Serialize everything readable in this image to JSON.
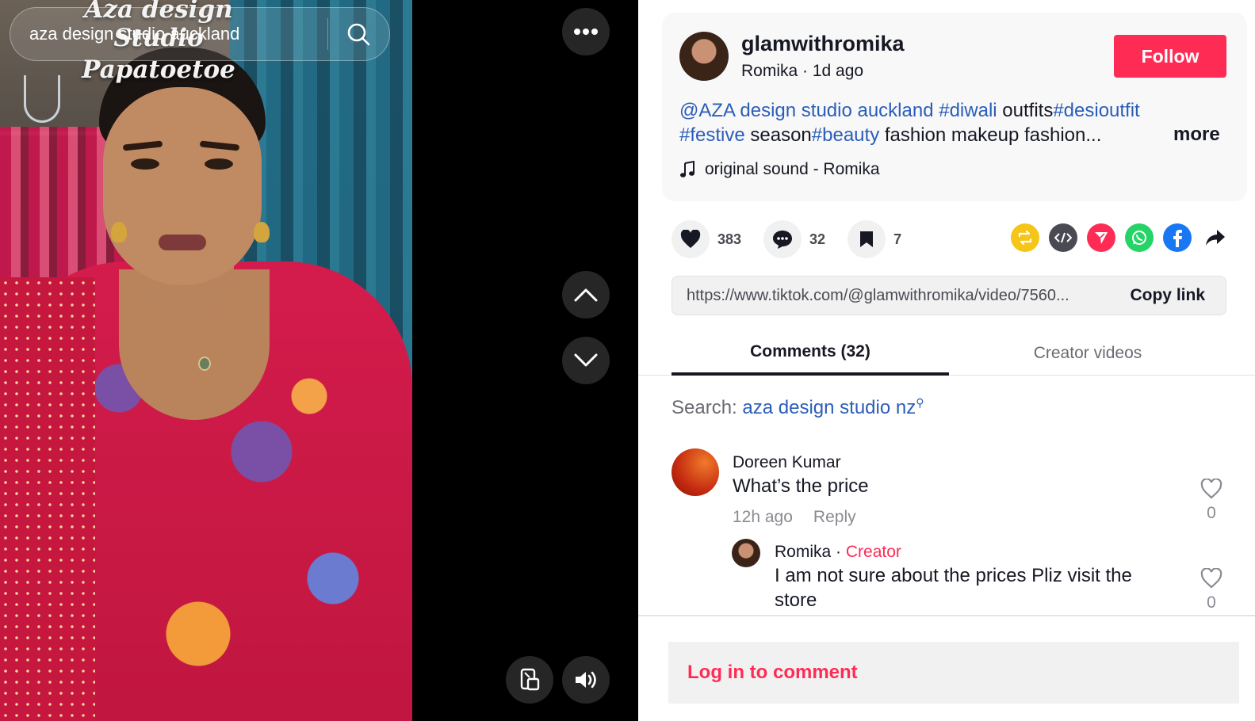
{
  "video": {
    "overlay_line1": "Aza design",
    "overlay_line2": "Studio",
    "overlay_line3": "Papatoetoe"
  },
  "search": {
    "value": "aza design studio auckland",
    "placeholder": "aza design studio auckland"
  },
  "author": {
    "username": "glamwithromika",
    "display_name": "Romika",
    "separator": " · ",
    "posted": "1d ago",
    "follow_label": "Follow"
  },
  "description": {
    "mention": "@AZA design studio auckland",
    "tag_diwali": "#diwali",
    "text_outfits": "outfits",
    "tag_desioutfit": "#desioutfit",
    "tag_festive": "#festive",
    "text_season": "season",
    "tag_beauty": "#beauty",
    "text_tail": "fashion makeup fashion...",
    "more_label": "more"
  },
  "music": {
    "label": "original sound - Romika"
  },
  "actions": {
    "likes": "383",
    "comments": "32",
    "saves": "7"
  },
  "share_colors": {
    "repost": "#f5c518",
    "embed": "#4a4a52",
    "send": "#fe2c55",
    "whatsapp": "#25d366",
    "facebook": "#1877f2"
  },
  "link": {
    "url": "https://www.tiktok.com/@glamwithromika/video/7560...",
    "copy_label": "Copy link"
  },
  "tabs": {
    "comments": "Comments (32)",
    "creator_videos": "Creator videos"
  },
  "search_suggest": {
    "prefix": "Search: ",
    "query": "aza design studio nz"
  },
  "comments": [
    {
      "name": "Doreen Kumar",
      "text": "What’s the price",
      "time": "12h ago",
      "reply_label": "Reply",
      "likes": "0"
    },
    {
      "name": "Romika",
      "separator": " · ",
      "badge": "Creator",
      "text": "I am not sure about the prices Pliz visit the store",
      "likes": "0"
    }
  ],
  "login": {
    "label": "Log in to comment"
  }
}
